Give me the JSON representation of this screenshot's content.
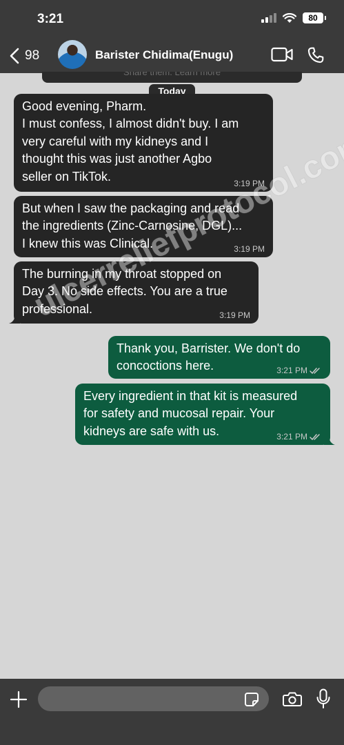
{
  "status": {
    "time": "3:21",
    "battery": "80"
  },
  "header": {
    "back_count": "98",
    "contact_name": "Barister Chidima(Enugu)"
  },
  "pinned": {
    "text": "Share them. Learn more"
  },
  "date_chip": "Today",
  "messages": [
    {
      "direction": "in",
      "lines": [
        "Good evening, Pharm.",
        "I must confess, I almost didn't buy. I am",
        "very careful with my kidneys and I",
        "thought this was just another Agbo",
        "seller on TikTok."
      ],
      "time": "3:19 PM"
    },
    {
      "direction": "in",
      "lines": [
        "But when I saw the packaging and read",
        "the ingredients (Zinc-Carnosine, DGL)...",
        "I knew this was Clinical."
      ],
      "time": "3:19 PM"
    },
    {
      "direction": "in",
      "lines": [
        "The burning in my throat stopped on",
        "Day 3. No side effects. You are a true",
        "professional."
      ],
      "time": "3:19 PM"
    },
    {
      "direction": "out",
      "lines": [
        "Thank you, Barrister. We don't do",
        "concoctions here."
      ],
      "time": "3:21 PM",
      "read": true
    },
    {
      "direction": "out",
      "lines": [
        "Every ingredient in that kit is measured",
        "for safety and mucosal repair. Your",
        "kidneys are safe with us."
      ],
      "time": "3:21 PM",
      "read": true
    }
  ],
  "watermark": "ulcerreliefprotocol.com",
  "composer": {
    "placeholder": ""
  },
  "icons": {
    "back": "chevron-left-icon",
    "video": "video-camera-icon",
    "call": "phone-icon",
    "plus": "plus-icon",
    "sticker": "sticker-icon",
    "camera": "camera-icon",
    "mic": "microphone-icon"
  },
  "colors": {
    "bar": "#3a3a3a",
    "chat_bg": "#d6d6d6",
    "incoming": "#252525",
    "outgoing": "#0d5c3f"
  }
}
